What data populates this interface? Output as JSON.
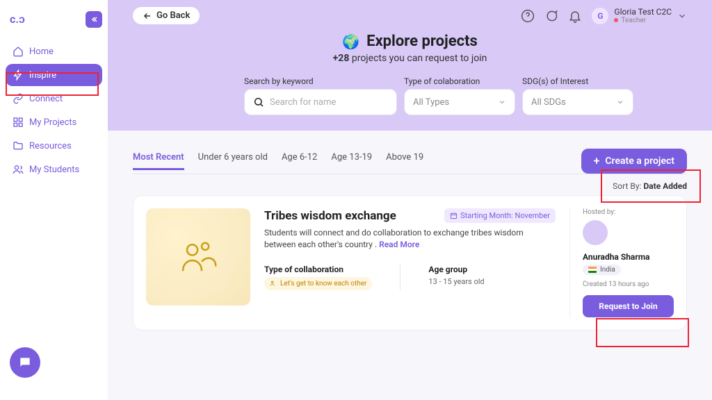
{
  "sidebar": {
    "items": [
      {
        "label": "Home"
      },
      {
        "label": "Inspire"
      },
      {
        "label": "Connect"
      },
      {
        "label": "My Projects"
      },
      {
        "label": "Resources"
      },
      {
        "label": "My Students"
      }
    ]
  },
  "top": {
    "back": "Go Back",
    "user_initial": "G",
    "user_name": "Gloria Test C2C",
    "user_role": "Teacher"
  },
  "hero": {
    "title": "Explore projects",
    "count": "+28",
    "subtitle_rest": " projects you can request to join"
  },
  "search": {
    "keyword_label": "Search by keyword",
    "keyword_placeholder": "Search for name",
    "type_label": "Type of colaboration",
    "type_value": "All Types",
    "sdg_label": "SDG(s) of Interest",
    "sdg_value": "All SDGs"
  },
  "tabs": {
    "items": [
      {
        "label": "Most Recent"
      },
      {
        "label": "Under 6 years old"
      },
      {
        "label": "Age 6-12"
      },
      {
        "label": "Age 13-19"
      },
      {
        "label": "Above 19"
      }
    ],
    "create": "Create a project"
  },
  "sort": {
    "prefix": "Sort By: ",
    "value": "Date Added"
  },
  "card": {
    "title": "Tribes wisdom exchange",
    "badge": "Starting Month: November",
    "desc": "Students will connect and do collaboration to exchange tribes wisdom between each other's country . ",
    "read_more": "Read More",
    "collab_h": "Type of collaboration",
    "collab_v": "Let's get to know each other",
    "age_h": "Age group",
    "age_v": "13 - 15 years old",
    "hosted": "Hosted by:",
    "host_name": "Anuradha Sharma",
    "host_country": "India",
    "posted": "Created 13 hours ago",
    "join": "Request to Join"
  }
}
